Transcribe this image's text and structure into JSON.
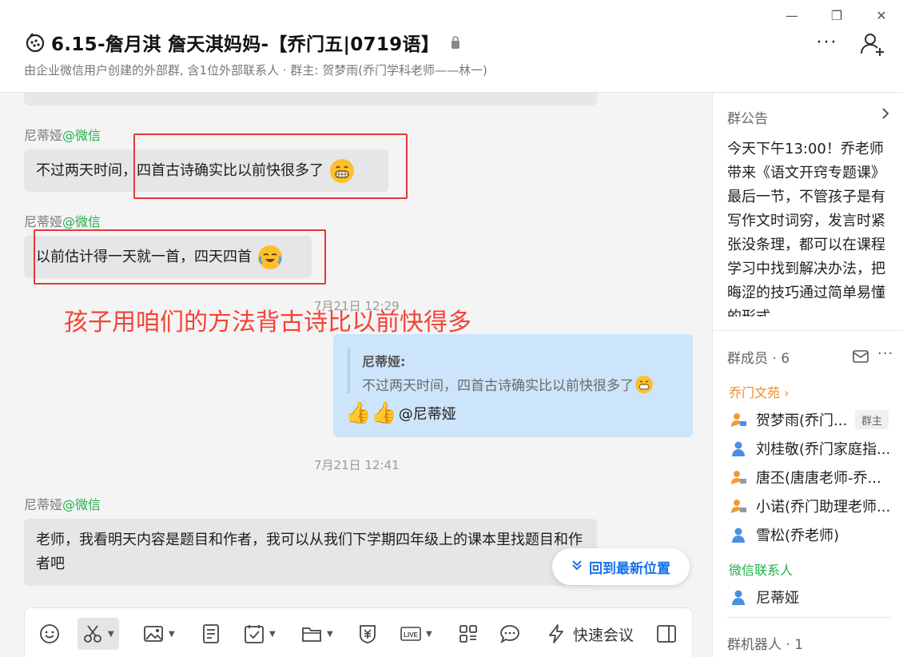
{
  "window": {
    "minimize": "—",
    "restore": "❐",
    "close": "✕"
  },
  "header": {
    "title": "6.15-詹月淇 詹天淇妈妈-【乔门五|0719语】",
    "subtitle": "由企业微信用户创建的外部群, 含1位外部联系人 · 群主: 贺梦雨(乔门学科老师——林一)",
    "more_label": "···"
  },
  "chat": {
    "messages": [
      {
        "sender": "尼蒂娅",
        "sender_tag": "@微信",
        "text_before": "不过两天时间，",
        "text_boxed": "四首古诗确实比以前快很多了"
      },
      {
        "sender": "尼蒂娅",
        "sender_tag": "@微信",
        "text": "以前估计得一天就一首，四天四首"
      }
    ],
    "annotation": "孩子用咱们的方法背古诗比以前快得多",
    "time1": "7月21日 12:29",
    "mine": {
      "quote_name": "尼蒂娅:",
      "quote_text": "不过两天时间，四首古诗确实比以前快很多了",
      "thumbs": "👍👍",
      "mention": "@尼蒂娅"
    },
    "time2": "7月21日 12:41",
    "last": {
      "sender": "尼蒂娅",
      "sender_tag": "@微信",
      "text": "老师，我看明天内容是题目和作者，我可以从我们下学期四年级上的课本里找题目和作者吧"
    },
    "jump_label": "回到最新位置"
  },
  "toolbar": {
    "quick_meeting": "快速会议"
  },
  "side": {
    "notice_title": "群公告",
    "notice_text": "今天下午13:00！乔老师带来《语文开窍专题课》最后一节，不管孩子是有写作文时词穷，发言时紧张没条理，都可以在课程学习中找到解决办法，把晦涩的技巧通过简单易懂的形式",
    "members_title": "群成员 · 6",
    "org_label": "乔门文苑 ›",
    "members": [
      {
        "name": "贺梦雨(乔门...",
        "badge": "群主"
      },
      {
        "name": "刘桂敬(乔门家庭指..."
      },
      {
        "name": "唐丕(唐唐老师-乔..."
      },
      {
        "name": "小诺(乔门助理老师..."
      },
      {
        "name": "雪松(乔老师)"
      }
    ],
    "wechat_label": "微信联系人",
    "wechat_members": [
      {
        "name": "尼蒂娅"
      }
    ],
    "robots_title": "群机器人 · 1"
  },
  "colors": {
    "accent_blue": "#1a73e8",
    "wechat_green": "#23b049",
    "annotation_red": "#f44336",
    "org_orange": "#f28b1b",
    "my_bubble": "#cde5fb"
  }
}
